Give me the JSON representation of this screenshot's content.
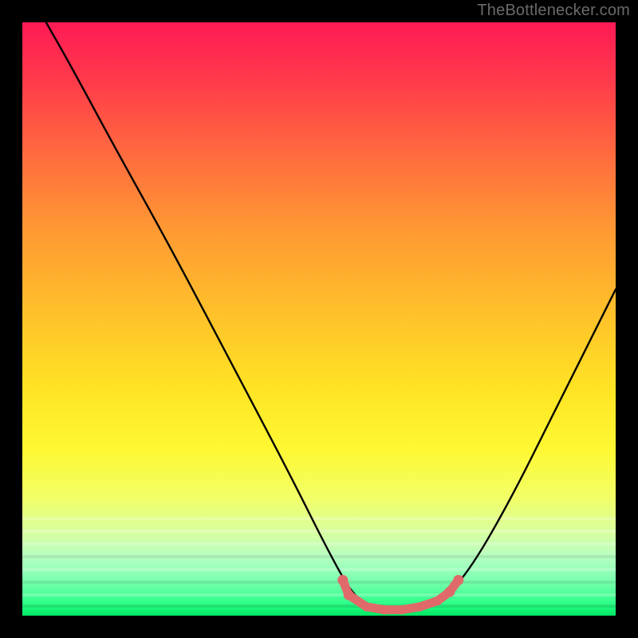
{
  "watermark": {
    "text": "TheBottlenecker.com"
  },
  "chart_data": {
    "type": "line",
    "title": "",
    "xlabel": "",
    "ylabel": "",
    "x_range": [
      0,
      100
    ],
    "y_range": [
      0,
      100
    ],
    "curve_points": [
      {
        "x": 4,
        "y": 100
      },
      {
        "x": 8,
        "y": 93
      },
      {
        "x": 15,
        "y": 80
      },
      {
        "x": 25,
        "y": 62
      },
      {
        "x": 35,
        "y": 43
      },
      {
        "x": 45,
        "y": 24
      },
      {
        "x": 52,
        "y": 10
      },
      {
        "x": 56,
        "y": 3
      },
      {
        "x": 60,
        "y": 1
      },
      {
        "x": 65,
        "y": 1
      },
      {
        "x": 70,
        "y": 2
      },
      {
        "x": 75,
        "y": 7
      },
      {
        "x": 82,
        "y": 19
      },
      {
        "x": 90,
        "y": 35
      },
      {
        "x": 100,
        "y": 55
      }
    ],
    "valley_marker_points": [
      {
        "x": 54,
        "y": 6
      },
      {
        "x": 55,
        "y": 3.5
      },
      {
        "x": 58,
        "y": 1.5
      },
      {
        "x": 61,
        "y": 1
      },
      {
        "x": 64,
        "y": 1
      },
      {
        "x": 67,
        "y": 1.5
      },
      {
        "x": 70,
        "y": 2.5
      },
      {
        "x": 72,
        "y": 4
      },
      {
        "x": 73.5,
        "y": 6
      }
    ],
    "colors": {
      "curve_stroke": "#000000",
      "marker_fill": "#e06a6a",
      "gradient_top": "#ff1a55",
      "gradient_mid": "#ffe424",
      "gradient_bottom": "#00e763",
      "background": "#000000",
      "watermark": "#6a6a6a"
    }
  }
}
